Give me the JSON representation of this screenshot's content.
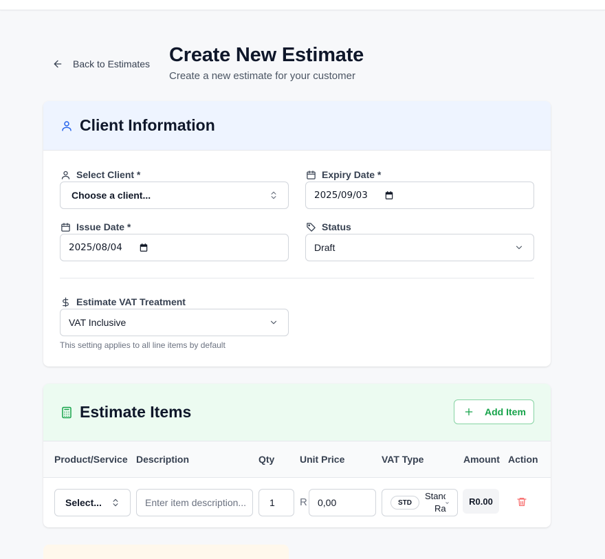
{
  "header": {
    "back_label": "Back to Estimates",
    "title": "Create New Estimate",
    "subtitle": "Create a new estimate for your customer"
  },
  "client_section": {
    "title": "Client Information",
    "select_client": {
      "label": "Select Client *",
      "value": "Choose a client..."
    },
    "expiry_date": {
      "label": "Expiry Date *",
      "value": "2025/09/03"
    },
    "issue_date": {
      "label": "Issue Date *",
      "value": "2025/08/04"
    },
    "status": {
      "label": "Status",
      "value": "Draft"
    },
    "vat_treatment": {
      "label": "Estimate VAT Treatment",
      "value": "VAT Inclusive",
      "hint": "This setting applies to all line items by default"
    }
  },
  "items_section": {
    "title": "Estimate Items",
    "add_label": "Add Item",
    "columns": [
      "Product/Service",
      "Description",
      "Qty",
      "Unit Price",
      "VAT Type",
      "Amount",
      "Action"
    ],
    "row": {
      "product": "Select...",
      "description_placeholder": "Enter item description...",
      "qty": "1",
      "currency": "R",
      "unit_price": "0,00",
      "vat_badge": "STD",
      "vat_text_1": "Stand",
      "vat_text_2": "Ra",
      "amount": "R0.00"
    }
  },
  "colors": {
    "client_header_bg": "#eef4ff",
    "items_header_bg": "#ecfbf1",
    "accent_blue": "#2563eb",
    "accent_green": "#16a34a",
    "danger": "#f87171"
  }
}
